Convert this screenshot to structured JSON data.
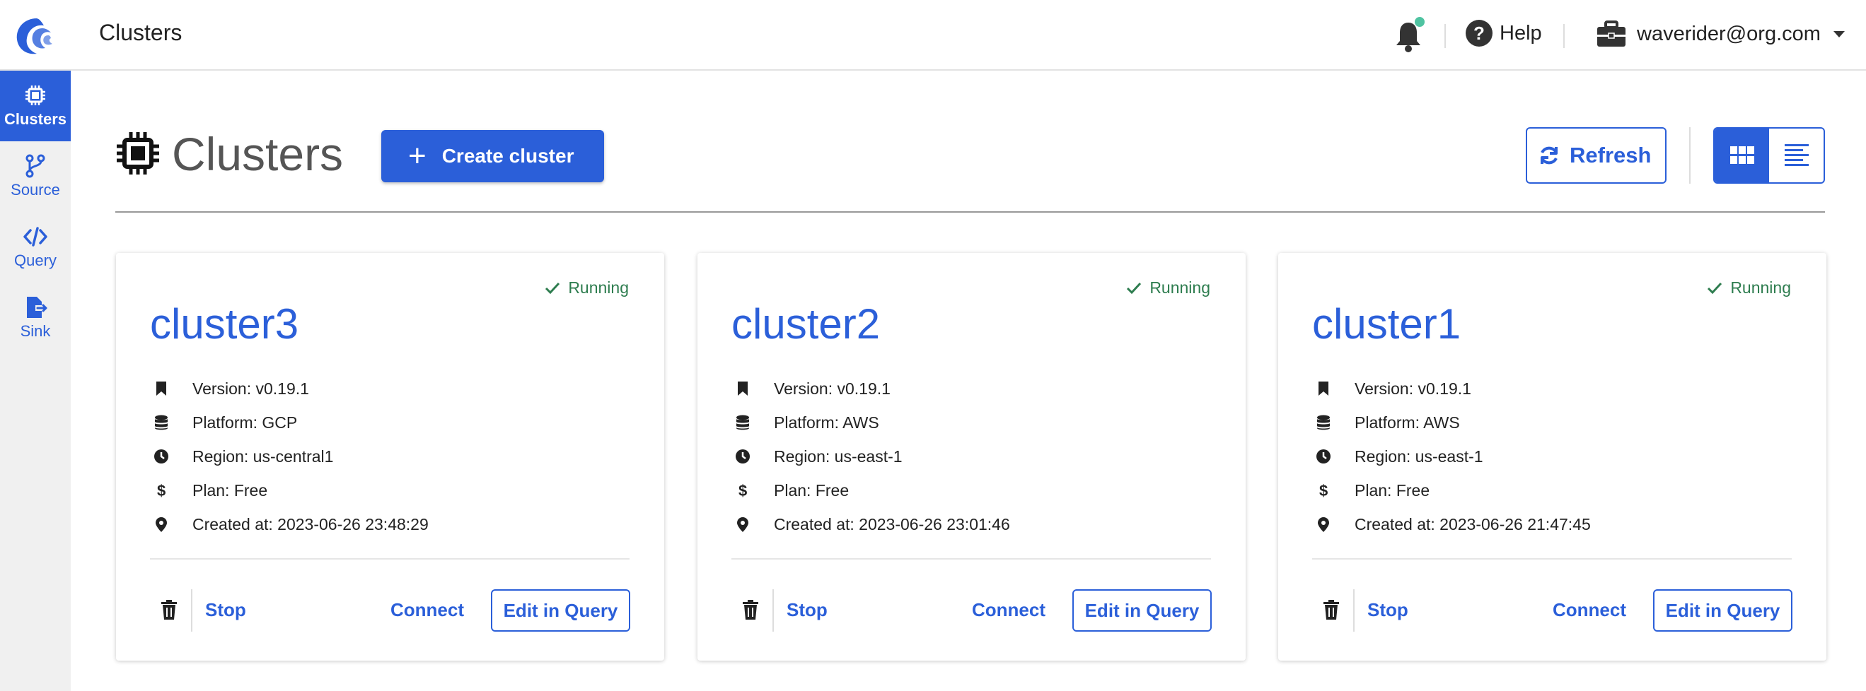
{
  "header": {
    "app_title": "Clusters",
    "help_label": "Help",
    "user_email": "waverider@org.com"
  },
  "sidebar": {
    "items": [
      {
        "label": "Clusters",
        "icon": "chip-icon",
        "active": true
      },
      {
        "label": "Source",
        "icon": "branch-icon",
        "active": false
      },
      {
        "label": "Query",
        "icon": "code-icon",
        "active": false
      },
      {
        "label": "Sink",
        "icon": "file-export-icon",
        "active": false
      }
    ]
  },
  "page": {
    "title": "Clusters",
    "create_label": "Create cluster",
    "refresh_label": "Refresh"
  },
  "colors": {
    "accent": "#2b5fd9",
    "running": "#2e7d4f",
    "notification_dot": "#4fc3a1"
  },
  "clusters": [
    {
      "name": "cluster3",
      "status": "Running",
      "version": "Version: v0.19.1",
      "platform": "Platform: GCP",
      "region": "Region: us-central1",
      "plan": "Plan: Free",
      "created": "Created at: 2023-06-26 23:48:29",
      "stop_label": "Stop",
      "connect_label": "Connect",
      "edit_label": "Edit in Query"
    },
    {
      "name": "cluster2",
      "status": "Running",
      "version": "Version: v0.19.1",
      "platform": "Platform: AWS",
      "region": "Region: us-east-1",
      "plan": "Plan: Free",
      "created": "Created at: 2023-06-26 23:01:46",
      "stop_label": "Stop",
      "connect_label": "Connect",
      "edit_label": "Edit in Query"
    },
    {
      "name": "cluster1",
      "status": "Running",
      "version": "Version: v0.19.1",
      "platform": "Platform: AWS",
      "region": "Region: us-east-1",
      "plan": "Plan: Free",
      "created": "Created at: 2023-06-26 21:47:45",
      "stop_label": "Stop",
      "connect_label": "Connect",
      "edit_label": "Edit in Query"
    }
  ]
}
